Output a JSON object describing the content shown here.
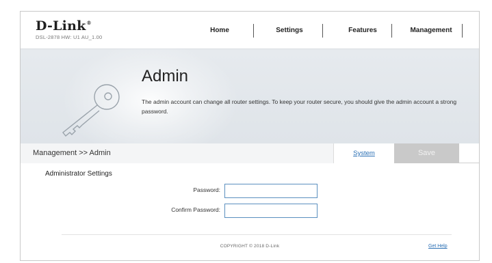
{
  "header": {
    "logo": "D-Link",
    "logo_mark": "®",
    "model_info": "DSL-2878   HW: U1   AU_1.00",
    "nav": [
      {
        "label": "Home"
      },
      {
        "label": "Settings"
      },
      {
        "label": "Features"
      },
      {
        "label": "Management"
      }
    ]
  },
  "banner": {
    "title": "Admin",
    "description": "The admin account can change all router settings. To keep your router secure, you should give the admin account a strong password.",
    "icon": "key-icon"
  },
  "toolbar": {
    "breadcrumb": "Management >> Admin",
    "system_label": "System",
    "save_label": "Save"
  },
  "admin_settings": {
    "section_title": "Administrator Settings",
    "password_label": "Password:",
    "password_value": "",
    "confirm_label": "Confirm Password:",
    "confirm_value": ""
  },
  "footer": {
    "copyright": "COPYRIGHT © 2018 D-Link",
    "help_label": "Get Help"
  },
  "colors": {
    "link": "#2a6fb4",
    "save_disabled": "#c9c9c9",
    "banner_bg": "#e3e7eb",
    "field_border": "#5a8fbf"
  }
}
